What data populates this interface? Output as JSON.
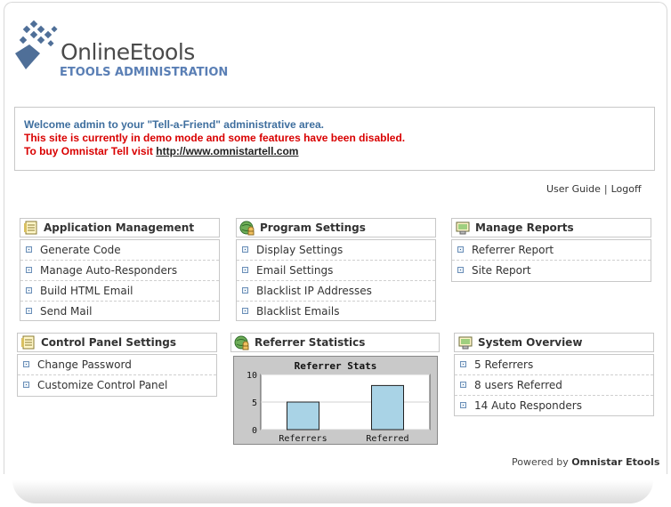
{
  "brand": {
    "title": "OnlineEtools",
    "subtitle": "ETOOLS ADMINISTRATION"
  },
  "notice": {
    "welcome": "Welcome admin to your \"Tell-a-Friend\" administrative area.",
    "demo": "This site is currently in demo mode and some features have been disabled.",
    "buy_prefix": "To buy Omnistar Tell visit ",
    "buy_link": "http://www.omnistartell.com"
  },
  "userlinks": {
    "guide": "User Guide",
    "separator": "|",
    "logoff": "Logoff"
  },
  "panels": {
    "app": {
      "title": "Application Management",
      "icon": "notepad-icon",
      "items": [
        "Generate Code",
        "Manage Auto-Responders",
        "Build HTML Email",
        "Send Mail"
      ]
    },
    "program": {
      "title": "Program Settings",
      "icon": "globe-user-icon",
      "items": [
        "Display Settings",
        "Email Settings",
        "Blacklist IP Addresses",
        "Blacklist Emails"
      ]
    },
    "reports": {
      "title": "Manage Reports",
      "icon": "monitor-icon",
      "items": [
        "Referrer Report",
        "Site Report"
      ]
    },
    "control": {
      "title": "Control Panel Settings",
      "icon": "notepad-icon",
      "items": [
        "Change Password",
        "Customize Control Panel"
      ]
    },
    "stats": {
      "title": "Referrer Statistics",
      "icon": "globe-user-icon"
    },
    "system": {
      "title": "System Overview",
      "icon": "monitor-icon",
      "items": [
        "5 Referrers",
        "8 users Referred",
        "14 Auto Responders"
      ]
    }
  },
  "chart_data": {
    "type": "bar",
    "title": "Referrer Stats",
    "categories": [
      "Referrers",
      "Referred"
    ],
    "values": [
      5,
      8
    ],
    "ylim": [
      0,
      10
    ],
    "yticks": [
      "10",
      "5",
      "0"
    ],
    "grid": true,
    "bar_color": "#a9d3e6"
  },
  "footer": {
    "prefix": "Powered by ",
    "brand": "Omnistar Etools"
  }
}
